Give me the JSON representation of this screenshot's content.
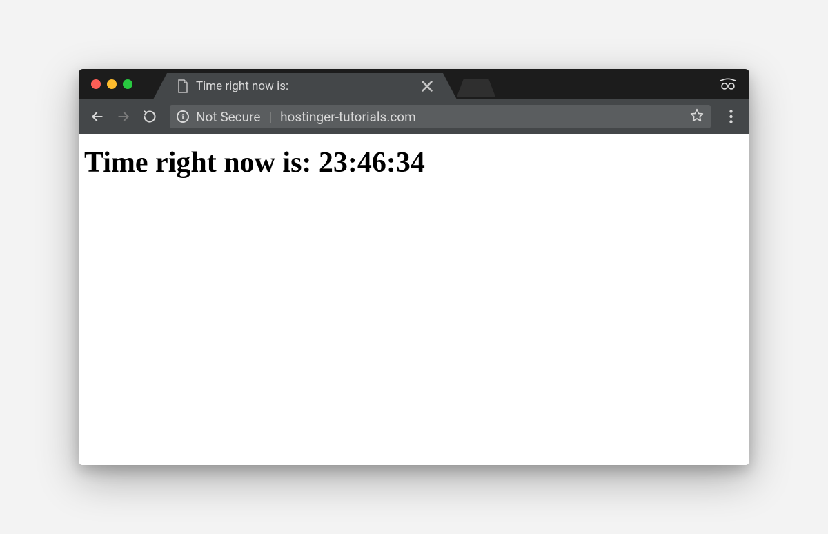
{
  "window": {
    "tab_title": "Time right now is:"
  },
  "toolbar": {
    "security_label": "Not Secure",
    "url": "hostinger-tutorials.com"
  },
  "page": {
    "heading_prefix": "Time right now is:  ",
    "time_value": "23:46:34"
  }
}
